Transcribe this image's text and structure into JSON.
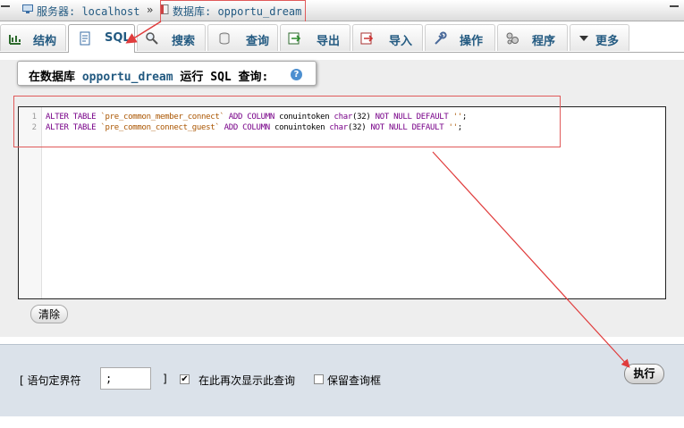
{
  "breadcrumb": {
    "server_label": "服务器: localhost",
    "separator": "»",
    "database_label": "数据库: opportu_dream"
  },
  "tabs": [
    {
      "label": "结构",
      "icon": "structure-icon"
    },
    {
      "label": "SQL",
      "icon": "sql-icon"
    },
    {
      "label": "搜索",
      "icon": "search-icon"
    },
    {
      "label": "查询",
      "icon": "query-icon"
    },
    {
      "label": "导出",
      "icon": "export-icon"
    },
    {
      "label": "导入",
      "icon": "import-icon"
    },
    {
      "label": "操作",
      "icon": "wrench-icon"
    },
    {
      "label": "程序",
      "icon": "routines-icon"
    },
    {
      "label": "更多",
      "icon": "chevron-down-icon"
    }
  ],
  "query_header": {
    "prefix": "在数据库",
    "database": "opportu_dream",
    "suffix": "运行 SQL 查询:",
    "help": "?"
  },
  "editor": {
    "lines": [
      {
        "number": "1",
        "kw1": "ALTER TABLE",
        "table": "`pre_common_member_connect`",
        "kw2": "ADD COLUMN",
        "column": "conuintoken",
        "type": "char",
        "size": "(32)",
        "kw3": "NOT NULL DEFAULT",
        "default": "''",
        "end": ";"
      },
      {
        "number": "2",
        "kw1": "ALTER TABLE",
        "table": "`pre_common_connect_guest`",
        "kw2": "ADD COLUMN",
        "column": "conuintoken",
        "type": "char",
        "size": "(32)",
        "kw3": "NOT NULL DEFAULT",
        "default": "''",
        "end": ";"
      }
    ]
  },
  "clear_button": "清除",
  "bottom": {
    "delimiter_open": "[ 语句定界符",
    "delimiter_value": ";",
    "delimiter_close": "]",
    "show_again_label": "在此再次显示此查询",
    "show_again_checked": true,
    "retain_label": "保留查询框",
    "retain_checked": false,
    "execute_button": "执行"
  },
  "colors": {
    "annotation": "#e03c3c",
    "link": "#235a81",
    "keyword": "#770088",
    "string": "#aa5500"
  }
}
